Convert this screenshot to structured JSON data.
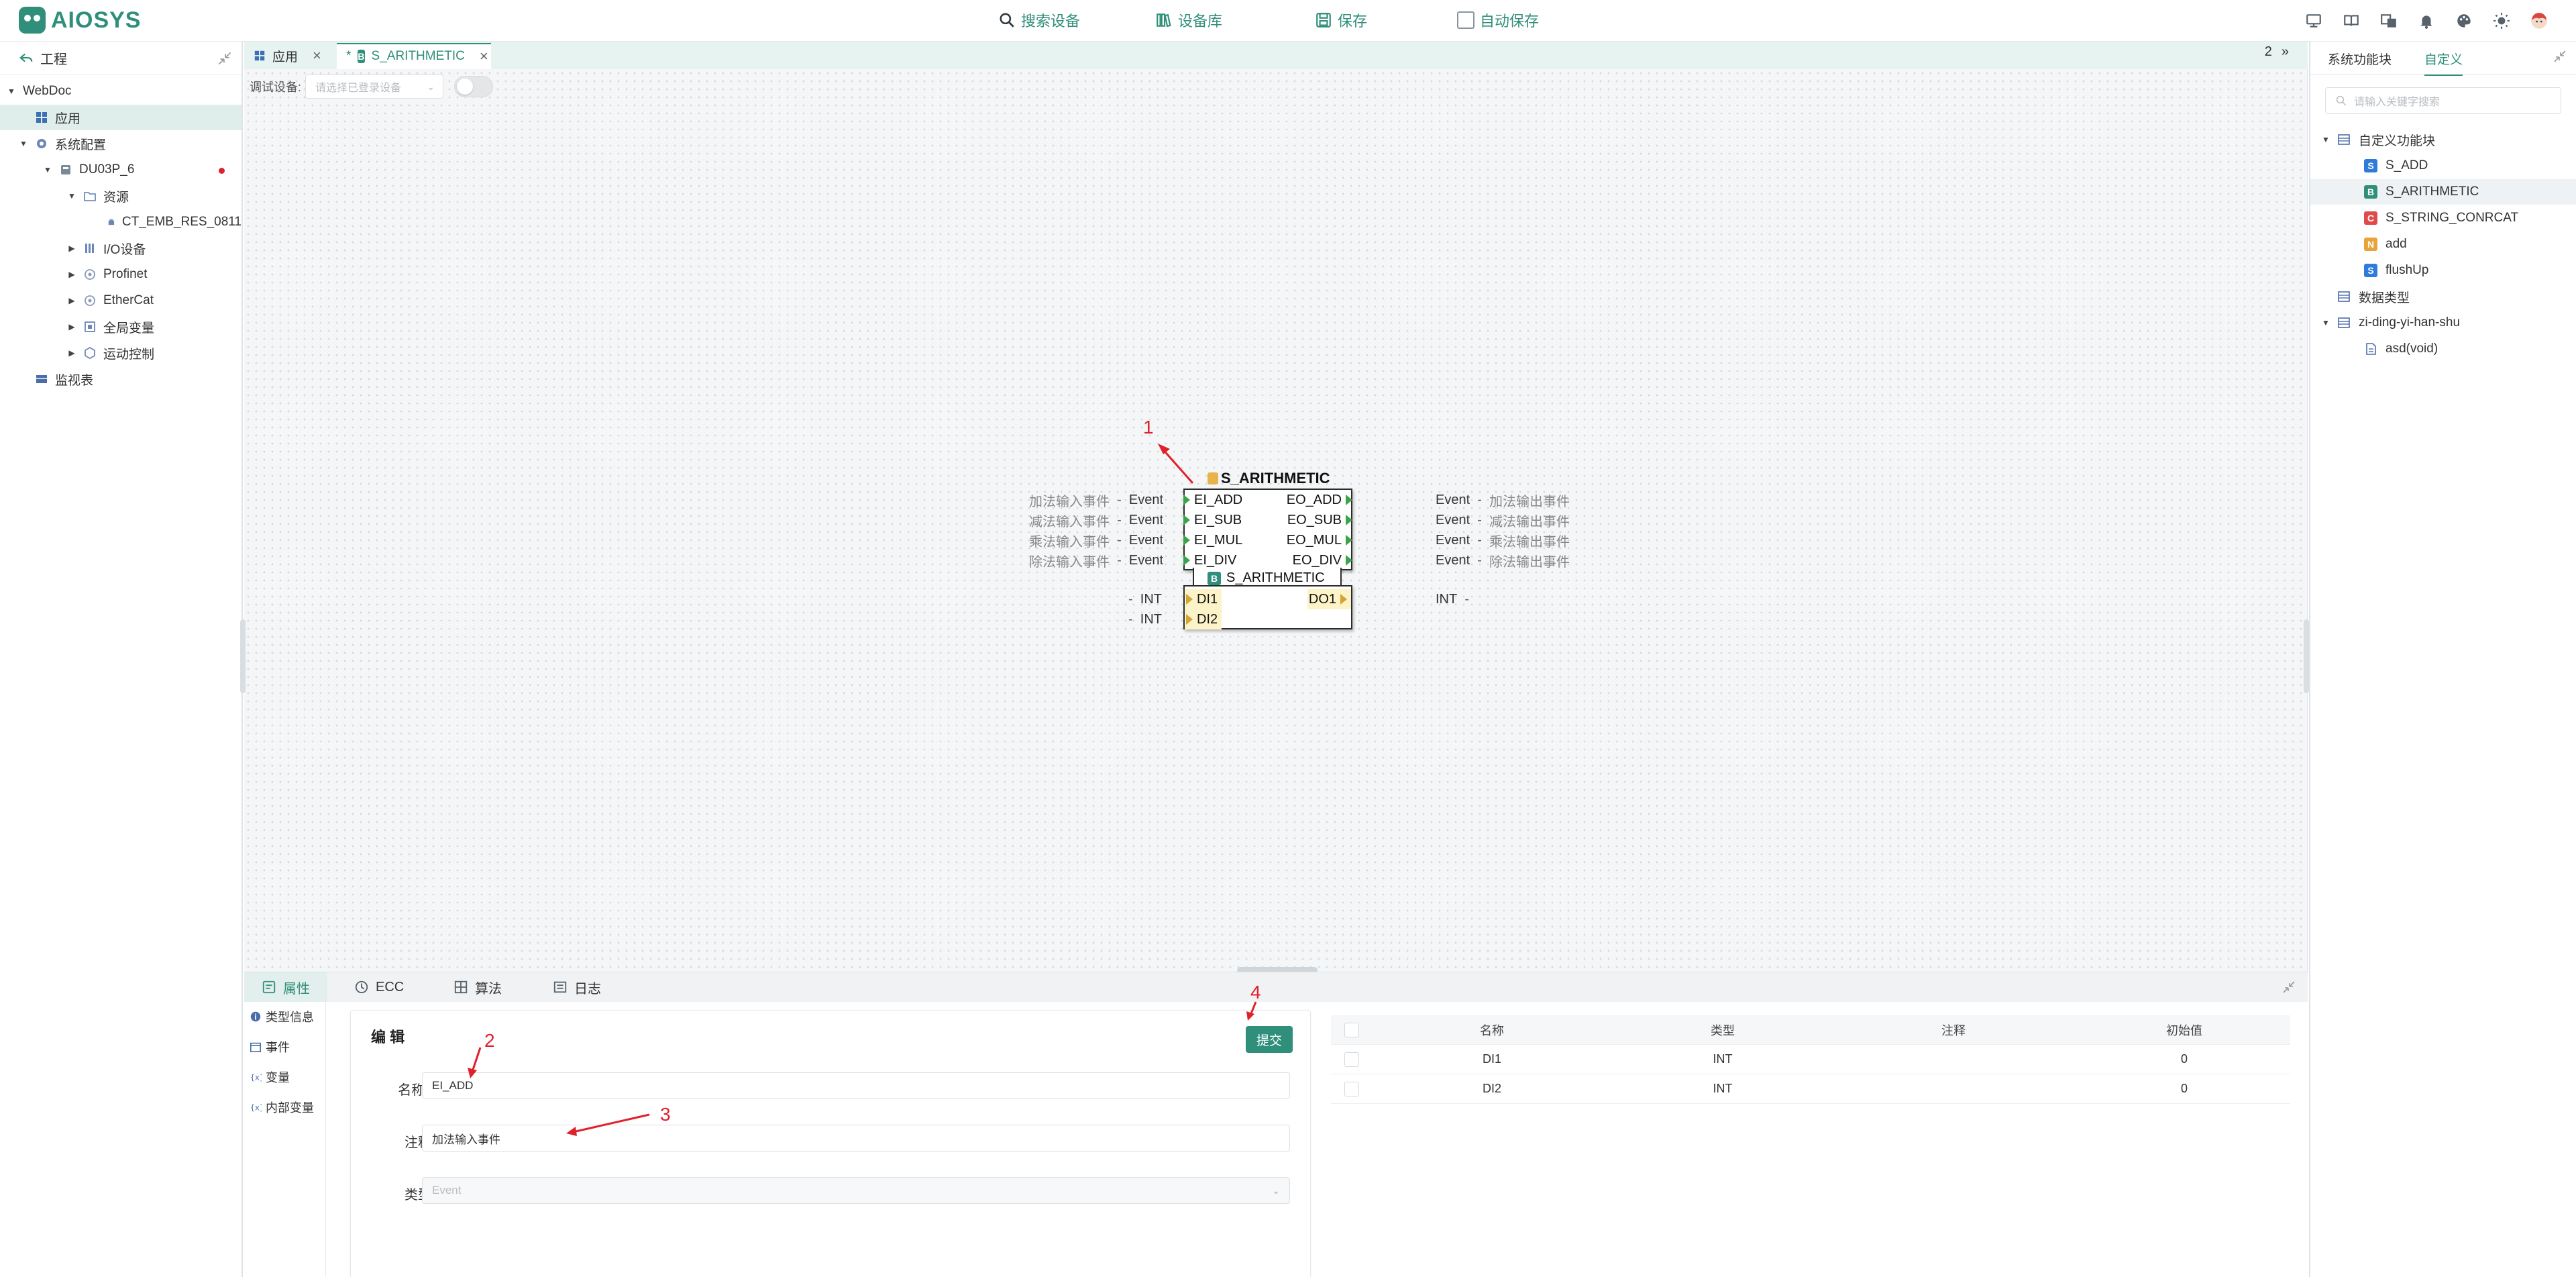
{
  "app": {
    "logo_text": "AIOSYS",
    "accent": "#2f8f7a",
    "annotation_color": "#e0202a"
  },
  "topbar": {
    "search_device": "搜索设备",
    "device_library": "设备库",
    "save": "保存",
    "auto_save": "自动保存",
    "right_icons": [
      "monitor-icon",
      "book-icon",
      "translate-icon",
      "bell-icon",
      "palette-icon",
      "sun-icon",
      "user-avatar"
    ]
  },
  "left": {
    "header": "工程",
    "tree": [
      {
        "label": "WebDoc"
      },
      {
        "label": "应用"
      },
      {
        "label": "系统配置"
      },
      {
        "label": "DU03P_6"
      },
      {
        "label": "资源"
      },
      {
        "label": "CT_EMB_RES_0811"
      },
      {
        "label": "I/O设备"
      },
      {
        "label": "Profinet"
      },
      {
        "label": "EtherCat"
      },
      {
        "label": "全局变量"
      },
      {
        "label": "运动控制"
      },
      {
        "label": "监视表"
      }
    ]
  },
  "tabs": {
    "items": [
      {
        "label": "应用"
      },
      {
        "label": "S_ARITHMETIC",
        "modified_mark": "*"
      }
    ],
    "page_count": "2",
    "more": "»"
  },
  "canvas": {
    "debug_label": "调试设备:",
    "debug_placeholder": "请选择已登录设备",
    "block": {
      "title": "S_ARITHMETIC",
      "type_label": "S_ARITHMETIC",
      "event_inputs": [
        "EI_ADD",
        "EI_SUB",
        "EI_MUL",
        "EI_DIV"
      ],
      "event_outputs": [
        "EO_ADD",
        "EO_SUB",
        "EO_MUL",
        "EO_DIV"
      ],
      "data_inputs": [
        "DI1",
        "DI2"
      ],
      "data_outputs": [
        "DO1"
      ]
    },
    "left_wires": [
      {
        "comment": "加法输入事件",
        "type": "Event"
      },
      {
        "comment": "减法输入事件",
        "type": "Event"
      },
      {
        "comment": "乘法输入事件",
        "type": "Event"
      },
      {
        "comment": "除法输入事件",
        "type": "Event"
      },
      {
        "comment": "",
        "type": "INT"
      },
      {
        "comment": "",
        "type": "INT"
      }
    ],
    "right_wires": [
      {
        "comment": "加法输出事件",
        "type": "Event"
      },
      {
        "comment": "减法输出事件",
        "type": "Event"
      },
      {
        "comment": "乘法输出事件",
        "type": "Event"
      },
      {
        "comment": "除法输出事件",
        "type": "Event"
      },
      {
        "comment": "",
        "type": "INT"
      }
    ],
    "annotations": [
      "1",
      "2",
      "3",
      "4"
    ]
  },
  "bottom": {
    "tabs": [
      "属性",
      "ECC",
      "算法",
      "日志"
    ],
    "side": [
      "类型信息",
      "事件",
      "变量",
      "内部变量"
    ],
    "edit": {
      "title": "编 辑",
      "submit": "提交",
      "name_label": "名称",
      "name_value": "EI_ADD",
      "comment_label": "注释",
      "comment_value": "加法输入事件",
      "type_label": "类型",
      "type_value": "Event"
    },
    "table": {
      "headers": [
        "名称",
        "类型",
        "注释",
        "初始值"
      ],
      "rows": [
        {
          "name": "DI1",
          "type": "INT",
          "comment": "",
          "init": "0"
        },
        {
          "name": "DI2",
          "type": "INT",
          "comment": "",
          "init": "0"
        }
      ]
    }
  },
  "right": {
    "tabs": [
      "系统功能块",
      "自定义"
    ],
    "search_placeholder": "请输入关键字搜索",
    "tree": [
      {
        "label": "自定义功能块"
      },
      {
        "label": "S_ADD",
        "badge": "S",
        "color": "#2f7bd9"
      },
      {
        "label": "S_ARITHMETIC",
        "badge": "B",
        "color": "#2f8f7a"
      },
      {
        "label": "S_STRING_CONRCAT",
        "badge": "C",
        "color": "#e04a4a"
      },
      {
        "label": "add",
        "badge": "N",
        "color": "#e8a33a"
      },
      {
        "label": "flushUp",
        "badge": "S",
        "color": "#2f7bd9"
      },
      {
        "label": "数据类型"
      },
      {
        "label": "zi-ding-yi-han-shu"
      },
      {
        "label": "asd(void)"
      }
    ]
  }
}
